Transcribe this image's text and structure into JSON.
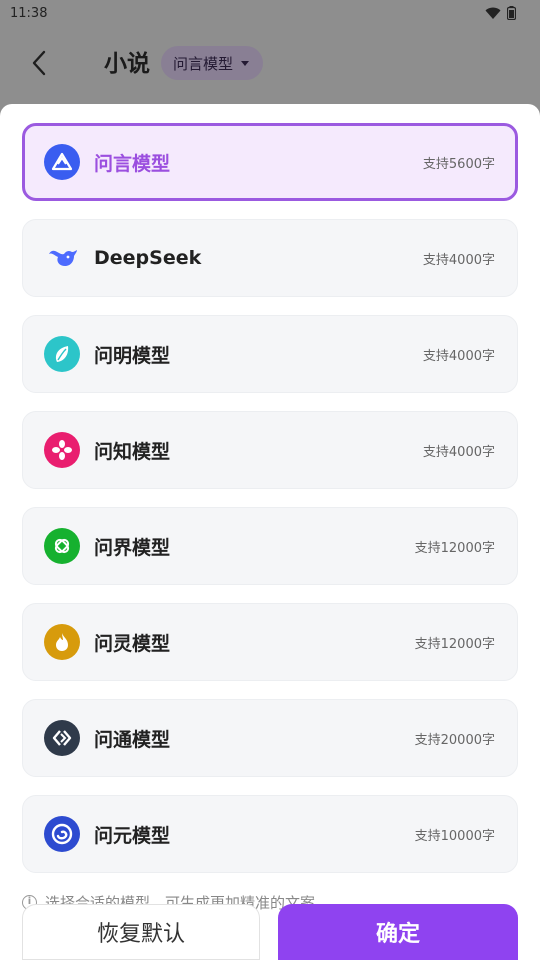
{
  "status_bar": {
    "time": "11:38"
  },
  "header": {
    "title": "小说",
    "model_selector_label": "问言模型"
  },
  "models": [
    {
      "name": "问言模型",
      "limit": "支持5600字",
      "icon": "wenyan-triangle-icon",
      "color": "#3a5df0",
      "selected": true
    },
    {
      "name": "DeepSeek",
      "limit": "支持4000字",
      "icon": "deepseek-whale-icon",
      "color": "#4d6bfe",
      "selected": false
    },
    {
      "name": "问明模型",
      "limit": "支持4000字",
      "icon": "leaf-icon",
      "color": "#2cc5c9",
      "selected": false
    },
    {
      "name": "问知模型",
      "limit": "支持4000字",
      "icon": "flower-icon",
      "color": "#e91e6f",
      "selected": false
    },
    {
      "name": "问界模型",
      "limit": "支持12000字",
      "icon": "knot-icon",
      "color": "#16b12f",
      "selected": false
    },
    {
      "name": "问灵模型",
      "limit": "支持12000字",
      "icon": "flame-icon",
      "color": "#d79b0c",
      "selected": false
    },
    {
      "name": "问通模型",
      "limit": "支持20000字",
      "icon": "chevrons-icon",
      "color": "#2f3a4a",
      "selected": false
    },
    {
      "name": "问元模型",
      "limit": "支持10000字",
      "icon": "swirl-icon",
      "color": "#2d4bd0",
      "selected": false
    }
  ],
  "hint": "选择合适的模型，可生成更加精准的文案",
  "buttons": {
    "reset": "恢复默认",
    "confirm": "确定"
  }
}
